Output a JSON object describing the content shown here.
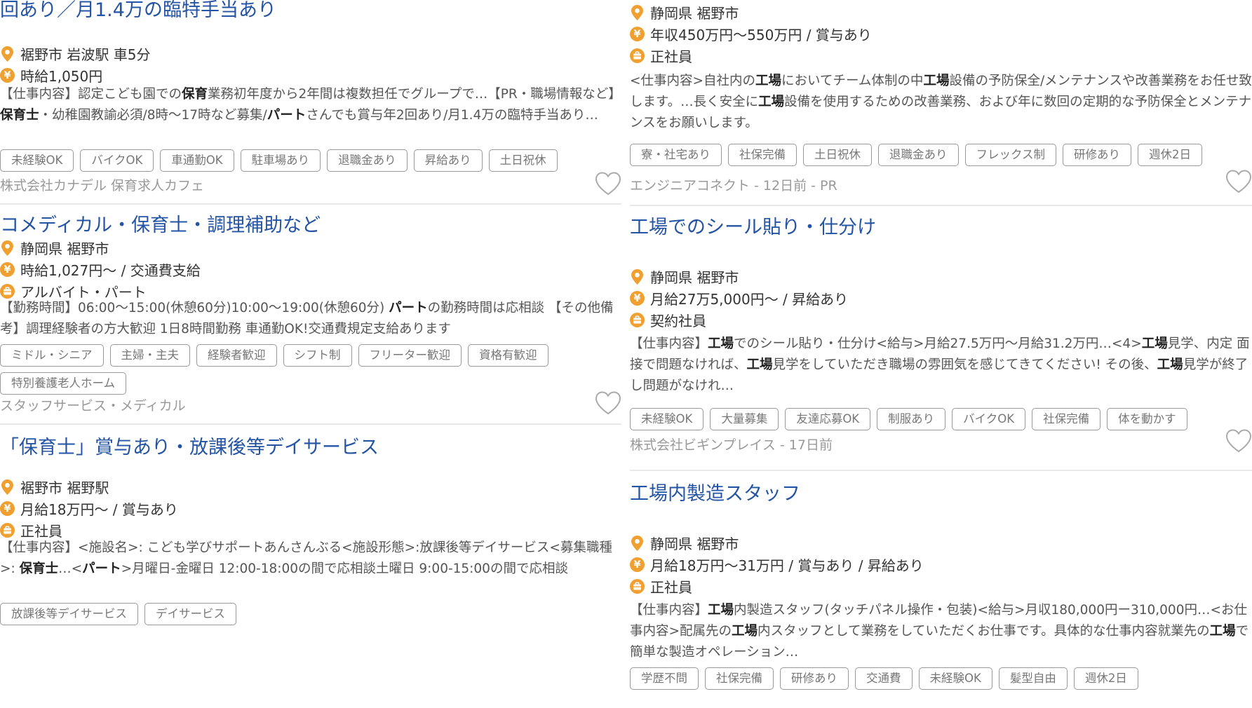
{
  "left_cards": [
    {
      "title": "回あり／月1.4万の臨特手当あり",
      "location": "裾野市 岩波駅 車5分",
      "salary": "時給1,050円",
      "employment": "",
      "description_html": "【仕事内容】認定こども園での<b>保育</b>業務初年度から2年間は複数担任でグループで…【PR・職場情報など】<b>保育士</b>・幼稚園教諭必須/8時～17時など募集/<b>パート</b>さんでも賞与年2回あり/月1.4万の臨特手当あり…",
      "tags": [
        "未経験OK",
        "バイクOK",
        "車通勤OK",
        "駐車場あり",
        "退職金あり",
        "昇給あり",
        "土日祝休"
      ],
      "company": "株式会社カナデル 保育求人カフェ"
    },
    {
      "title": "コメディカル・保育士・調理補助など",
      "location": "静岡県 裾野市",
      "salary": "時給1,027円～ / 交通費支給",
      "employment": "アルバイト・パート",
      "description_html": "【勤務時間】06:00～15:00(休憩60分)10:00～19:00(休憩60分) <b>パート</b>の勤務時間は応相談 【その他備考】調理経験者の方大歓迎 1日8時間勤務 車通勤OK!交通費規定支給あります",
      "tags": [
        "ミドル・シニア",
        "主婦・主夫",
        "経験者歓迎",
        "シフト制",
        "フリーター歓迎",
        "資格有歓迎",
        "特別養護老人ホーム"
      ],
      "company": "スタッフサービス・メディカル"
    },
    {
      "title": "「保育士」賞与あり・放課後等デイサービス",
      "location": "裾野市 裾野駅",
      "salary": "月給18万円～ / 賞与あり",
      "employment": "正社員",
      "description_html": "【仕事内容】&lt;施設名&gt;: こども学びサポートあんさんぶる&lt;施設形態&gt;:放課後等デイサービス&lt;募集職種&gt;: <b>保育士</b>…&lt;<b>パート</b>&gt;月曜日-金曜日 12:00-18:00の間で応相談土曜日 9:00-15:00の間で応相談",
      "tags": [
        "放課後等デイサービス",
        "デイサービス"
      ],
      "company": ""
    }
  ],
  "right_cards": [
    {
      "title": "",
      "location": "静岡県 裾野市",
      "salary": "年収450万円～550万円 / 賞与あり",
      "employment": "正社員",
      "description_html": "&lt;仕事内容&gt;自社内の<b>工場</b>においてチーム体制の中<b>工場</b>設備の予防保全/メンテナンスや改善業務をお任せ致します。…長く安全に<b>工場</b>設備を使用するための改善業務、および年に数回の定期的な予防保全とメンテナンスをお願いします。",
      "tags": [
        "寮・社宅あり",
        "社保完備",
        "土日祝休",
        "退職金あり",
        "フレックス制",
        "研修あり",
        "週休2日"
      ],
      "company": "エンジニアコネクト - 12日前 - PR"
    },
    {
      "title": "工場でのシール貼り・仕分け",
      "location": "静岡県 裾野市",
      "salary": "月給27万5,000円～ / 昇給あり",
      "employment": "契約社員",
      "description_html": "【仕事内容】<b>工場</b>でのシール貼り・仕分け&lt;給与&gt;月給27.5万円～月給31.2万円…&lt;4&gt;<b>工場</b>見学、内定 面接で問題なければ、<b>工場</b>見学をしていただき職場の雰囲気を感じてきてください! その後、<b>工場</b>見学が終了し問題がなけれ…",
      "tags": [
        "未経験OK",
        "大量募集",
        "友達応募OK",
        "制服あり",
        "バイクOK",
        "社保完備",
        "体を動かす"
      ],
      "company": "株式会社ビギンプレイス - 17日前"
    },
    {
      "title": "工場内製造スタッフ",
      "location": "静岡県 裾野市",
      "salary": "月給18万円～31万円 / 賞与あり / 昇給あり",
      "employment": "正社員",
      "description_html": "【仕事内容】<b>工場</b>内製造スタッフ(タッチパネル操作・包装)&lt;給与&gt;月収180,000円ー310,000円…&lt;お仕事内容&gt;配属先の<b>工場</b>内スタッフとして業務をしていただくお仕事です。具体的な仕事内容就業先の<b>工場</b>で簡単な製造オペレーション…",
      "tags": [
        "学歴不問",
        "社保完備",
        "研修あり",
        "交通費",
        "未経験OK",
        "髪型自由",
        "週休2日"
      ],
      "company": ""
    }
  ],
  "icons": {
    "location": "map-pin-icon",
    "salary": "yen-icon",
    "employment": "briefcase-icon",
    "favorite": "heart-icon"
  },
  "colors": {
    "title": "#2454a3",
    "icon": "#f0a030",
    "tag_border": "#999999"
  }
}
